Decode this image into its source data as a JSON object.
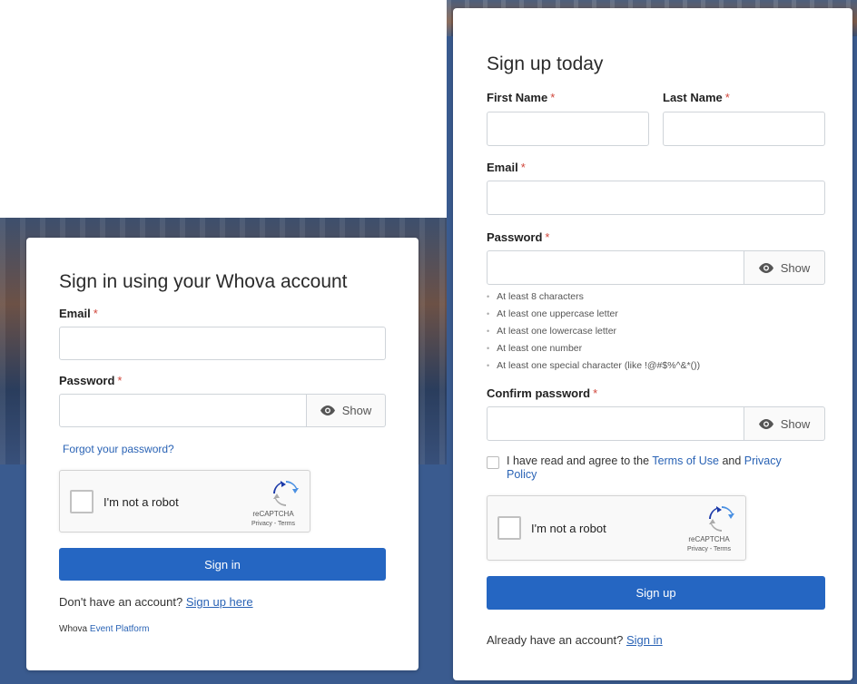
{
  "signin": {
    "title": "Sign in using your Whova account",
    "email_label": "Email",
    "password_label": "Password",
    "required_mark": "*",
    "show_label": "Show",
    "forgot_link": "Forgot your password?",
    "captcha_text": "I'm not a robot",
    "captcha_brand": "reCAPTCHA",
    "captcha_legal": "Privacy - Terms",
    "signin_button": "Sign in",
    "no_account_text": "Don't have an account?",
    "signup_link": "Sign up here",
    "footer_brand": "Whova",
    "footer_link": "Event Platform"
  },
  "signup": {
    "title": "Sign up today",
    "first_name_label": "First Name",
    "last_name_label": "Last Name",
    "email_label": "Email",
    "password_label": "Password",
    "confirm_label": "Confirm password",
    "required_mark": "*",
    "show_label": "Show",
    "password_rules": [
      "At least 8 characters",
      "At least one uppercase letter",
      "At least one lowercase letter",
      "At least one number",
      "At least one special character (like !@#$%^&*())"
    ],
    "agree_text": "I have read and agree to the",
    "terms_link": "Terms of Use",
    "and_text": "and",
    "privacy_link_1": "Privacy",
    "privacy_link_2": "Policy",
    "captcha_text": "I'm not a robot",
    "captcha_brand": "reCAPTCHA",
    "captcha_legal": "Privacy - Terms",
    "signup_button": "Sign up",
    "have_account_text": "Already have an account?",
    "signin_link": "Sign in"
  },
  "colors": {
    "primary": "#2566c2",
    "link": "#2a63b5",
    "required": "#d0453a",
    "background": "#3a5b8f"
  }
}
